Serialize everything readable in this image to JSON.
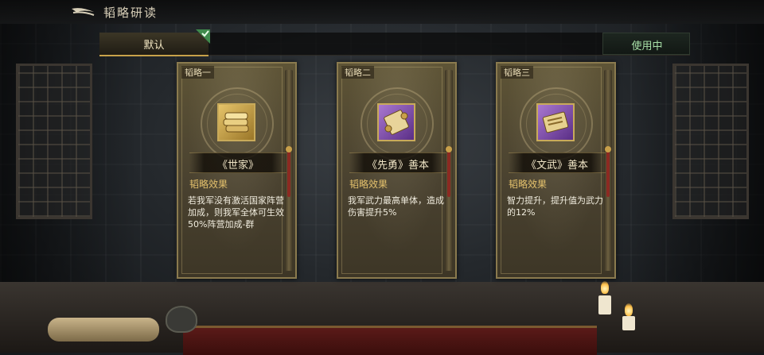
{
  "header": {
    "title": "韬略研读",
    "back_icon": "back-arrow-icon"
  },
  "tabs": {
    "default_label": "默认",
    "default_selected": true,
    "in_use_label": "使用中"
  },
  "colors": {
    "accent_gold": "#c8a24a",
    "in_use_green": "#a8e0a8",
    "effect_title": "#e3c06c"
  },
  "cards": [
    {
      "slot_label": "韬略一",
      "icon": "gold-book-bundle-icon",
      "name": "《世家》",
      "effect_title": "韬略效果",
      "effect_desc": "若我军没有激活国家阵营加成，则我军全体可生效50%阵营加成-群"
    },
    {
      "slot_label": "韬略二",
      "icon": "purple-scroll-icon",
      "name": "《先勇》善本",
      "effect_title": "韬略效果",
      "effect_desc": "我军武力最高单体，造成伤害提升5%"
    },
    {
      "slot_label": "韬略三",
      "icon": "purple-book-icon",
      "name": "《文武》善本",
      "effect_title": "韬略效果",
      "effect_desc": "智力提升，提升值为武力的12%"
    }
  ]
}
